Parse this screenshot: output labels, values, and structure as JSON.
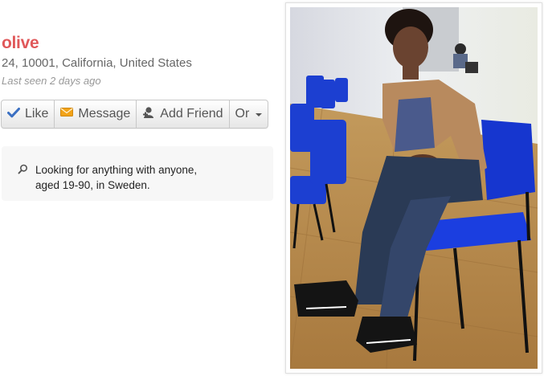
{
  "profile": {
    "name": "olive",
    "location": "24, 10001, California, United States",
    "last_seen": "Last seen 2 days ago"
  },
  "actions": {
    "like": "Like",
    "message": "Message",
    "add_friend": "Add Friend",
    "more": "Or"
  },
  "looking_for": {
    "line1": "Looking for anything with anyone,",
    "line2": "aged 19-90, in Sweden."
  },
  "colors": {
    "name": "#e0585a",
    "like_icon": "#3a6fc2",
    "message_icon": "#f2a318",
    "chair_blue": "#1c3fd1"
  },
  "icons": [
    "check-icon",
    "envelope-icon",
    "add-person-icon",
    "caret-down-icon",
    "search-icon"
  ]
}
